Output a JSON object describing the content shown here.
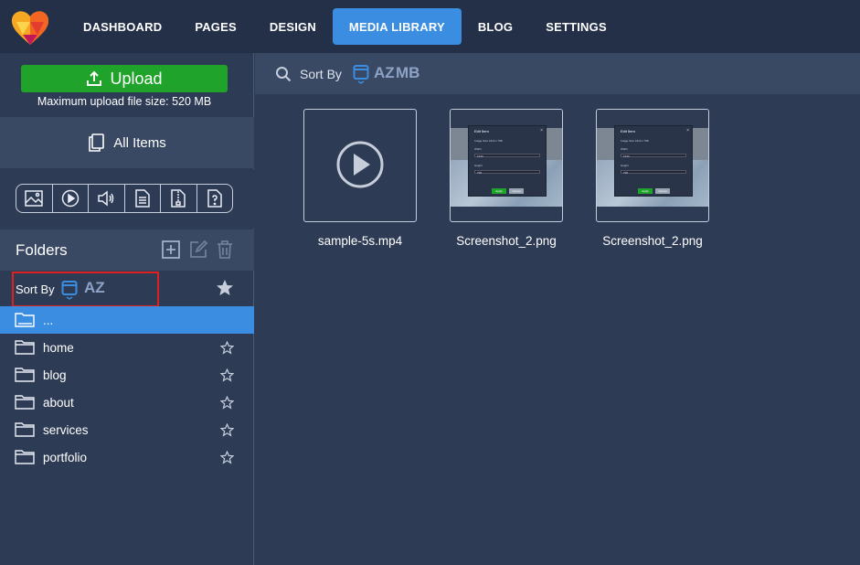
{
  "nav": {
    "items": [
      {
        "label": "DASHBOARD",
        "active": false
      },
      {
        "label": "PAGES",
        "active": false
      },
      {
        "label": "DESIGN",
        "active": false
      },
      {
        "label": "MEDIA LIBRARY",
        "active": true
      },
      {
        "label": "BLOG",
        "active": false
      },
      {
        "label": "SETTINGS",
        "active": false
      }
    ]
  },
  "sidebar": {
    "upload_label": "Upload",
    "upload_note": "Maximum upload file size: 520 MB",
    "all_items_label": "All Items",
    "type_filters": [
      "image-icon",
      "video-icon",
      "audio-icon",
      "document-icon",
      "archive-icon",
      "unknown-file-icon"
    ],
    "folders_title": "Folders",
    "sort_label": "Sort By",
    "sort_az": "AZ",
    "folders": [
      {
        "name": "...",
        "selected": true
      },
      {
        "name": "home",
        "selected": false
      },
      {
        "name": "blog",
        "selected": false
      },
      {
        "name": "about",
        "selected": false
      },
      {
        "name": "services",
        "selected": false
      },
      {
        "name": "portfolio",
        "selected": false
      }
    ]
  },
  "main": {
    "sort_label": "Sort By",
    "sort_az": "AZ",
    "sort_mb": "MB",
    "items": [
      {
        "name": "sample-5s.mp4",
        "kind": "video"
      },
      {
        "name": "Screenshot_2.png",
        "kind": "image"
      },
      {
        "name": "Screenshot_2.png",
        "kind": "image"
      }
    ],
    "thumb_dialog": {
      "title": "Edit Item",
      "line1": "Image Size 1916 x 798",
      "width_label": "Width",
      "width_value": "1916",
      "height_label": "Height",
      "height_value": "798",
      "apply": "Apply",
      "cancel": "Cancel"
    }
  },
  "colors": {
    "accent": "#3a8de0",
    "upload_green": "#1fa32a",
    "highlight_red": "#e0201e"
  }
}
